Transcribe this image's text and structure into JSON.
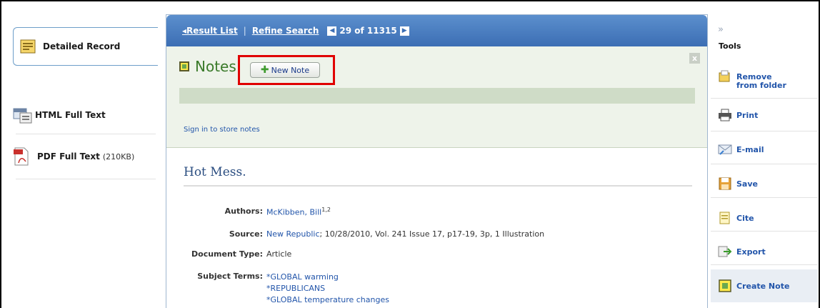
{
  "topbar": {
    "result_list": "◂Result List",
    "refine_search": "Refine Search",
    "separator": "|",
    "prev_icon": "◀",
    "next_icon": "▶",
    "position": "29 of 11315"
  },
  "left_nav": {
    "collapse": "«",
    "items": [
      {
        "label": "Detailed Record",
        "icon": "record-icon"
      },
      {
        "label": "HTML Full Text",
        "icon": "html-icon"
      },
      {
        "label": "PDF Full Text",
        "size": "(210KB)",
        "icon": "pdf-icon"
      }
    ]
  },
  "notes": {
    "title": "Notes",
    "new_note": "New Note",
    "close": "x",
    "signin": "Sign in to store notes"
  },
  "record": {
    "title": "Hot Mess.",
    "authors_label": "Authors:",
    "author_name": "McKibben, Bill",
    "author_sup": "1,2",
    "source_label": "Source:",
    "source_link": "New Republic",
    "source_rest": "; 10/28/2010, Vol. 241 Issue 17, p17-19, 3p, 1 Illustration",
    "doctype_label": "Document Type:",
    "doctype": "Article",
    "subjects_label": "Subject Terms:",
    "subjects": [
      "*GLOBAL warming",
      "*REPUBLICANS",
      "*GLOBAL temperature changes"
    ]
  },
  "tools": {
    "collapse": "»",
    "title": "Tools",
    "items": [
      {
        "label": "Remove from folder",
        "icon": "folder-icon"
      },
      {
        "label": "Print",
        "icon": "printer-icon"
      },
      {
        "label": "E-mail",
        "icon": "email-icon"
      },
      {
        "label": "Save",
        "icon": "save-icon"
      },
      {
        "label": "Cite",
        "icon": "cite-icon"
      },
      {
        "label": "Export",
        "icon": "export-icon"
      },
      {
        "label": "Create Note",
        "icon": "note-icon"
      }
    ]
  },
  "colors": {
    "topbar": "#4a7fc2",
    "notes_bg": "#eef3ea",
    "notes_title": "#3a7a2a",
    "highlight": "#e00000",
    "link": "#2255aa"
  }
}
